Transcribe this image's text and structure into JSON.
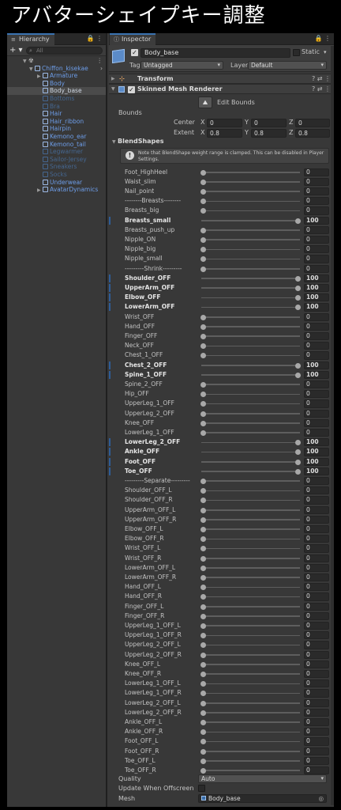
{
  "title": "アバターシェイプキー調整",
  "hierarchy": {
    "tab_label": "Hierarchy",
    "tab_tools": "🔒 ⋮",
    "add_label": "+ ▾",
    "search_placeholder": "All",
    "scene_label": "",
    "root_label": "Chiffon_kisekae",
    "items": [
      {
        "label": "Armature",
        "arrow": "▶"
      },
      {
        "label": "Body",
        "arrow": ""
      },
      {
        "label": "Body_base",
        "arrow": ""
      },
      {
        "label": "Bottoms",
        "arrow": ""
      },
      {
        "label": "Bra",
        "arrow": ""
      },
      {
        "label": "Hair",
        "arrow": ""
      },
      {
        "label": "Hair_ribbon",
        "arrow": ""
      },
      {
        "label": "Hairpin",
        "arrow": ""
      },
      {
        "label": "Kemono_ear",
        "arrow": ""
      },
      {
        "label": "Kemono_tail",
        "arrow": ""
      },
      {
        "label": "Legwarmer",
        "arrow": ""
      },
      {
        "label": "Sailor-Jersey",
        "arrow": ""
      },
      {
        "label": "Sneakers",
        "arrow": ""
      },
      {
        "label": "Socks",
        "arrow": ""
      },
      {
        "label": "Underwear",
        "arrow": ""
      },
      {
        "label": "AvatarDynamics",
        "arrow": "▶"
      }
    ]
  },
  "inspector": {
    "tab_label": "Inspector",
    "tab_tools": "🔒 ⋮",
    "object_name": "Body_base",
    "static_label": "Static",
    "tag_label": "Tag",
    "tag_value": "Untagged",
    "layer_label": "Layer",
    "layer_value": "Default",
    "transform_label": "Transform",
    "renderer_label": "Skinned Mesh Renderer",
    "comp_tools": "? ⇄ ⋮",
    "edit_bounds_label": "Edit Bounds",
    "bounds_label": "Bounds",
    "center_label": "Center",
    "extent_label": "Extent",
    "x_label": "X",
    "y_label": "Y",
    "z_label": "Z",
    "center": {
      "x": "0",
      "y": "0",
      "z": "0"
    },
    "extent": {
      "x": "0.8",
      "y": "0.8",
      "z": "0.8"
    },
    "blendshapes_label": "BlendShapes",
    "help_text": "Note that BlendShape weight range is clamped. This can be disabled in Player Settings.",
    "blendshapes": [
      {
        "name": "Foot_HighHeel",
        "value": 0
      },
      {
        "name": "Waist_slim",
        "value": 0
      },
      {
        "name": "Nail_point",
        "value": 0
      },
      {
        "name": "--------Breasts--------",
        "value": 0
      },
      {
        "name": "Breasts_big",
        "value": 0
      },
      {
        "name": "Breasts_small",
        "value": 100
      },
      {
        "name": "Breasts_push_up",
        "value": 0
      },
      {
        "name": "Nipple_ON",
        "value": 0
      },
      {
        "name": "Nipple_big",
        "value": 0
      },
      {
        "name": "Nipple_small",
        "value": 0
      },
      {
        "name": "---------Shrink---------",
        "value": 0
      },
      {
        "name": "Shoulder_OFF",
        "value": 100
      },
      {
        "name": "UpperArm_OFF",
        "value": 100
      },
      {
        "name": "Elbow_OFF",
        "value": 100
      },
      {
        "name": "LowerArm_OFF",
        "value": 100
      },
      {
        "name": "Wrist_OFF",
        "value": 0
      },
      {
        "name": "Hand_OFF",
        "value": 0
      },
      {
        "name": "Finger_OFF",
        "value": 0
      },
      {
        "name": "Neck_OFF",
        "value": 0
      },
      {
        "name": "Chest_1_OFF",
        "value": 0
      },
      {
        "name": "Chest_2_OFF",
        "value": 100
      },
      {
        "name": "Spine_1_OFF",
        "value": 100
      },
      {
        "name": "Spine_2_OFF",
        "value": 0
      },
      {
        "name": "Hip_OFF",
        "value": 0
      },
      {
        "name": "UpperLeg_1_OFF",
        "value": 0
      },
      {
        "name": "UpperLeg_2_OFF",
        "value": 0
      },
      {
        "name": "Knee_OFF",
        "value": 0
      },
      {
        "name": "LowerLeg_1_OFF",
        "value": 0
      },
      {
        "name": "LowerLeg_2_OFF",
        "value": 100
      },
      {
        "name": "Ankle_OFF",
        "value": 100
      },
      {
        "name": "Foot_OFF",
        "value": 100
      },
      {
        "name": "Toe_OFF",
        "value": 100
      },
      {
        "name": "---------Separate---------",
        "value": 0
      },
      {
        "name": "Shoulder_OFF_L",
        "value": 0
      },
      {
        "name": "Shoulder_OFF_R",
        "value": 0
      },
      {
        "name": "UpperArm_OFF_L",
        "value": 0
      },
      {
        "name": "UpperArm_OFF_R",
        "value": 0
      },
      {
        "name": "Elbow_OFF_L",
        "value": 0
      },
      {
        "name": "Elbow_OFF_R",
        "value": 0
      },
      {
        "name": "Wrist_OFF_L",
        "value": 0
      },
      {
        "name": "Wrist_OFF_R",
        "value": 0
      },
      {
        "name": "LowerArm_OFF_L",
        "value": 0
      },
      {
        "name": "LowerArm_OFF_R",
        "value": 0
      },
      {
        "name": "Hand_OFF_L",
        "value": 0
      },
      {
        "name": "Hand_OFF_R",
        "value": 0
      },
      {
        "name": "Finger_OFF_L",
        "value": 0
      },
      {
        "name": "Finger_OFF_R",
        "value": 0
      },
      {
        "name": "UpperLeg_1_OFF_L",
        "value": 0
      },
      {
        "name": "UpperLeg_1_OFF_R",
        "value": 0
      },
      {
        "name": "UpperLeg_2_OFF_L",
        "value": 0
      },
      {
        "name": "UpperLeg_2_OFF_R",
        "value": 0
      },
      {
        "name": "Knee_OFF_L",
        "value": 0
      },
      {
        "name": "Knee_OFF_R",
        "value": 0
      },
      {
        "name": "LowerLeg_1_OFF_L",
        "value": 0
      },
      {
        "name": "LowerLeg_1_OFF_R",
        "value": 0
      },
      {
        "name": "LowerLeg_2_OFF_L",
        "value": 0
      },
      {
        "name": "LowerLeg_2_OFF_R",
        "value": 0
      },
      {
        "name": "Ankle_OFF_L",
        "value": 0
      },
      {
        "name": "Ankle_OFF_R",
        "value": 0
      },
      {
        "name": "Foot_OFF_L",
        "value": 0
      },
      {
        "name": "Foot_OFF_R",
        "value": 0
      },
      {
        "name": "Toe_OFF_L",
        "value": 0
      },
      {
        "name": "Toe_OFF_R",
        "value": 0
      }
    ],
    "quality_label": "Quality",
    "quality_value": "Auto",
    "update_offscreen_label": "Update When Offscreen",
    "mesh_label": "Mesh",
    "mesh_value": "Body_base"
  },
  "colors": {
    "background": "#383838",
    "accent": "#3a72b0",
    "link_blue": "#6d9de8"
  }
}
